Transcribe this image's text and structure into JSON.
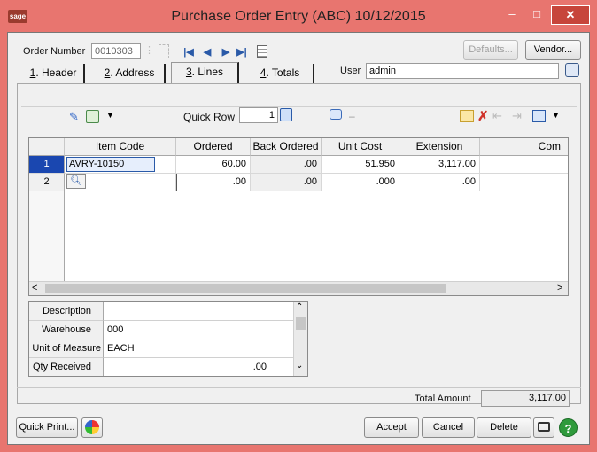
{
  "window": {
    "logo": "sage",
    "title": "Purchase Order Entry (ABC) 10/12/2015",
    "minimize": "–",
    "maximize": "□",
    "close": "✕"
  },
  "header": {
    "order_number_label": "Order Number",
    "order_number_value": "0010303",
    "defaults_button": "Defaults...",
    "vendor_button": "Vendor...",
    "user_label": "User",
    "user_value": "admin"
  },
  "tabs": [
    {
      "key": "1",
      "label": ". Header"
    },
    {
      "key": "2",
      "label": ". Address"
    },
    {
      "key": "3",
      "label": ". Lines",
      "active": true
    },
    {
      "key": "4",
      "label": ". Totals"
    }
  ],
  "toolbar": {
    "quick_row_label": "Quick Row",
    "quick_row_value": "1",
    "note_dash": "–"
  },
  "grid": {
    "columns": [
      "Item Code",
      "Ordered",
      "Back Ordered",
      "Unit Cost",
      "Extension",
      "Com"
    ],
    "rows": [
      {
        "num": "1",
        "item_code": "AVRY-10150",
        "ordered": "60.00",
        "back_ordered": ".00",
        "unit_cost": "51.950",
        "extension": "3,117.00",
        "comment": ""
      },
      {
        "num": "2",
        "item_code": "",
        "ordered": ".00",
        "back_ordered": ".00",
        "unit_cost": ".000",
        "extension": ".00",
        "comment": ""
      }
    ]
  },
  "details": [
    {
      "label": "Description",
      "value": ""
    },
    {
      "label": "Warehouse",
      "value": "000"
    },
    {
      "label": "Unit of Measure",
      "value": "EACH"
    },
    {
      "label": "Qty Received",
      "value": ".00"
    }
  ],
  "totals": {
    "total_amount_label": "Total Amount",
    "total_amount_value": "3,117.00"
  },
  "footer": {
    "quick_print_button": "Quick Print...",
    "accept_button": "Accept",
    "cancel_button": "Cancel",
    "delete_button": "Delete"
  },
  "colors": {
    "titlebar": "#e8756f",
    "close_button": "#c7453b",
    "selected_row": "#1a47b0"
  }
}
